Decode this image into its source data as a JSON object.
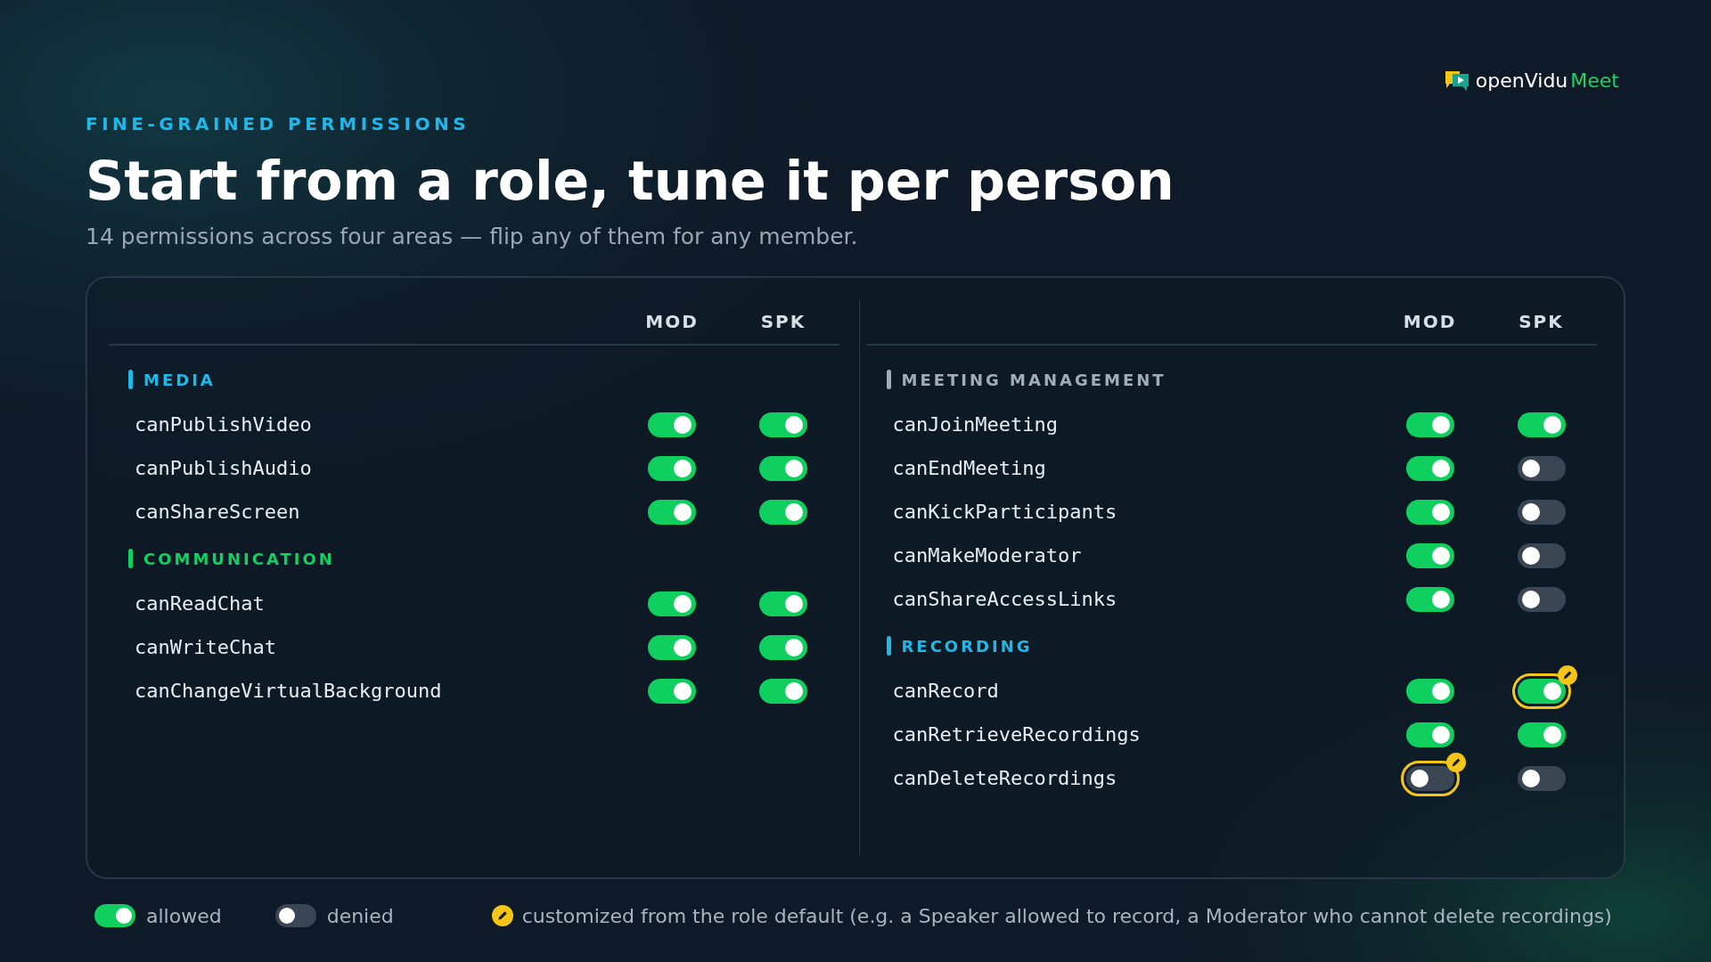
{
  "logo": {
    "name": "openVidu",
    "accent": "Meet"
  },
  "eyebrow": "FINE-GRAINED PERMISSIONS",
  "title": "Start from a role, tune it per person",
  "subtitle": "14 permissions across four areas — flip any of them for any member.",
  "panels": [
    {
      "columns": [
        "MOD",
        "SPK"
      ],
      "sections": [
        {
          "title": "MEDIA",
          "color": "#1fb8e8",
          "permissions": [
            {
              "name": "canPublishVideo",
              "values": [
                {
                  "on": true,
                  "customized": false
                },
                {
                  "on": true,
                  "customized": false
                }
              ]
            },
            {
              "name": "canPublishAudio",
              "values": [
                {
                  "on": true,
                  "customized": false
                },
                {
                  "on": true,
                  "customized": false
                }
              ]
            },
            {
              "name": "canShareScreen",
              "values": [
                {
                  "on": true,
                  "customized": false
                },
                {
                  "on": true,
                  "customized": false
                }
              ]
            }
          ]
        },
        {
          "title": "COMMUNICATION",
          "color": "#12cf62",
          "permissions": [
            {
              "name": "canReadChat",
              "values": [
                {
                  "on": true,
                  "customized": false
                },
                {
                  "on": true,
                  "customized": false
                }
              ]
            },
            {
              "name": "canWriteChat",
              "values": [
                {
                  "on": true,
                  "customized": false
                },
                {
                  "on": true,
                  "customized": false
                }
              ]
            },
            {
              "name": "canChangeVirtualBackground",
              "values": [
                {
                  "on": true,
                  "customized": false
                },
                {
                  "on": true,
                  "customized": false
                }
              ]
            }
          ]
        }
      ]
    },
    {
      "columns": [
        "MOD",
        "SPK"
      ],
      "sections": [
        {
          "title": "MEETING MANAGEMENT",
          "color": "#a3adb8",
          "permissions": [
            {
              "name": "canJoinMeeting",
              "values": [
                {
                  "on": true,
                  "customized": false
                },
                {
                  "on": true,
                  "customized": false
                }
              ]
            },
            {
              "name": "canEndMeeting",
              "values": [
                {
                  "on": true,
                  "customized": false
                },
                {
                  "on": false,
                  "customized": false
                }
              ]
            },
            {
              "name": "canKickParticipants",
              "values": [
                {
                  "on": true,
                  "customized": false
                },
                {
                  "on": false,
                  "customized": false
                }
              ]
            },
            {
              "name": "canMakeModerator",
              "values": [
                {
                  "on": true,
                  "customized": false
                },
                {
                  "on": false,
                  "customized": false
                }
              ]
            },
            {
              "name": "canShareAccessLinks",
              "values": [
                {
                  "on": true,
                  "customized": false
                },
                {
                  "on": false,
                  "customized": false
                }
              ]
            }
          ]
        },
        {
          "title": "RECORDING",
          "color": "#1fb8e8",
          "permissions": [
            {
              "name": "canRecord",
              "values": [
                {
                  "on": true,
                  "customized": false
                },
                {
                  "on": true,
                  "customized": true
                }
              ]
            },
            {
              "name": "canRetrieveRecordings",
              "values": [
                {
                  "on": true,
                  "customized": false
                },
                {
                  "on": true,
                  "customized": false
                }
              ]
            },
            {
              "name": "canDeleteRecordings",
              "values": [
                {
                  "on": false,
                  "customized": true
                },
                {
                  "on": false,
                  "customized": false
                }
              ]
            }
          ]
        }
      ]
    }
  ],
  "legend": [
    {
      "kind": "toggle",
      "on": true,
      "label": "allowed"
    },
    {
      "kind": "toggle",
      "on": false,
      "label": "denied"
    },
    {
      "kind": "custom",
      "label": "customized from the role default (e.g. a Speaker allowed to record, a Moderator who cannot delete recordings)"
    }
  ]
}
